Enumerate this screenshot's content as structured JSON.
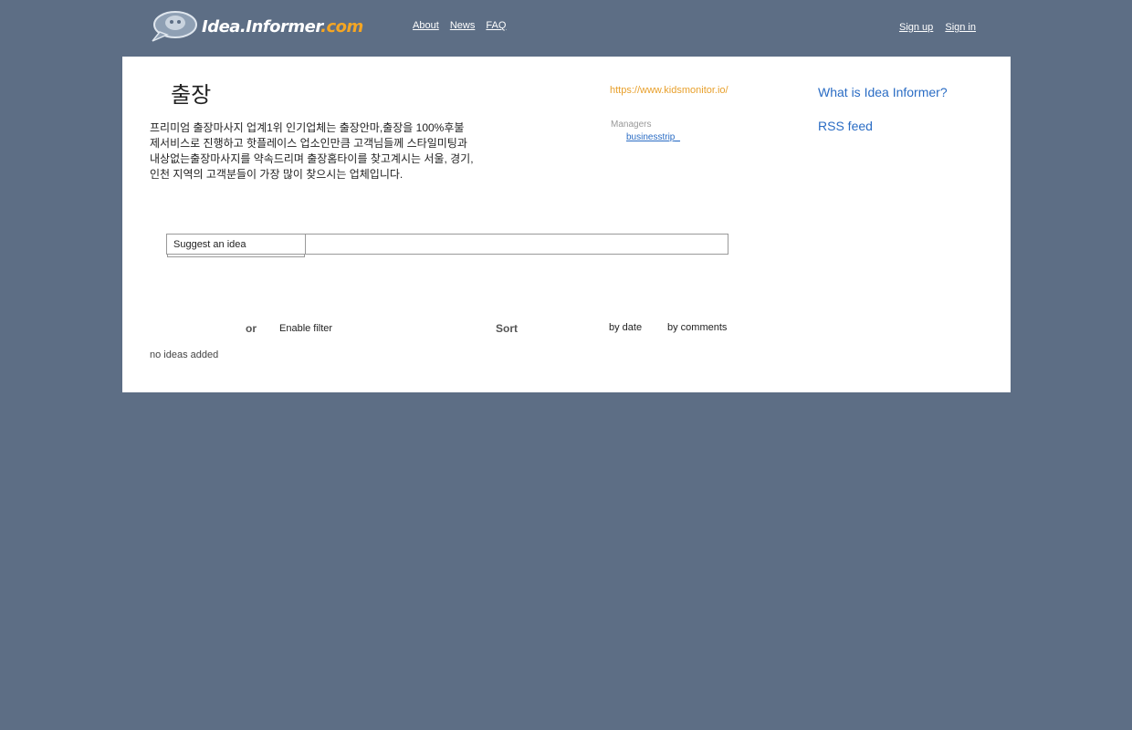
{
  "header": {
    "logo_text": "Idea.Informer",
    "logo_suffix": ".com",
    "nav": [
      "About",
      "News",
      "FAQ"
    ],
    "auth": {
      "signup": "Sign up",
      "signin": "Sign in"
    }
  },
  "project": {
    "title": "출장",
    "description": "프리미엄 출장마사지 업계1위 인기업체는 출장안마,출장을 100%후불제서비스로 진행하고 핫플레이스 업소인만큼 고객님들께 스타일미팅과 내상없는출장마사지를 약속드리며 출장홈타이를 찾고계시는 서울, 경기, 인천 지역의 고객분들이 가장 많이 찾으시는 업체입니다.",
    "url": "https://www.kidsmonitor.io/",
    "managers_label": "Managers",
    "manager": "businesstrip_"
  },
  "sidebar": {
    "what_is": "What is Idea Informer?",
    "rss": "RSS feed"
  },
  "suggest": {
    "tab_label": "Suggest an idea",
    "input_value": ""
  },
  "filters": {
    "or_label": "or",
    "enable_filter": "Enable filter",
    "sort_label": "Sort",
    "by_date": "by date",
    "by_comments": "by comments"
  },
  "ideas": {
    "empty_message": "no ideas added"
  },
  "colors": {
    "background": "#5d6e85",
    "link_blue": "#2a6cc4",
    "accent_orange": "#e8a02c"
  }
}
